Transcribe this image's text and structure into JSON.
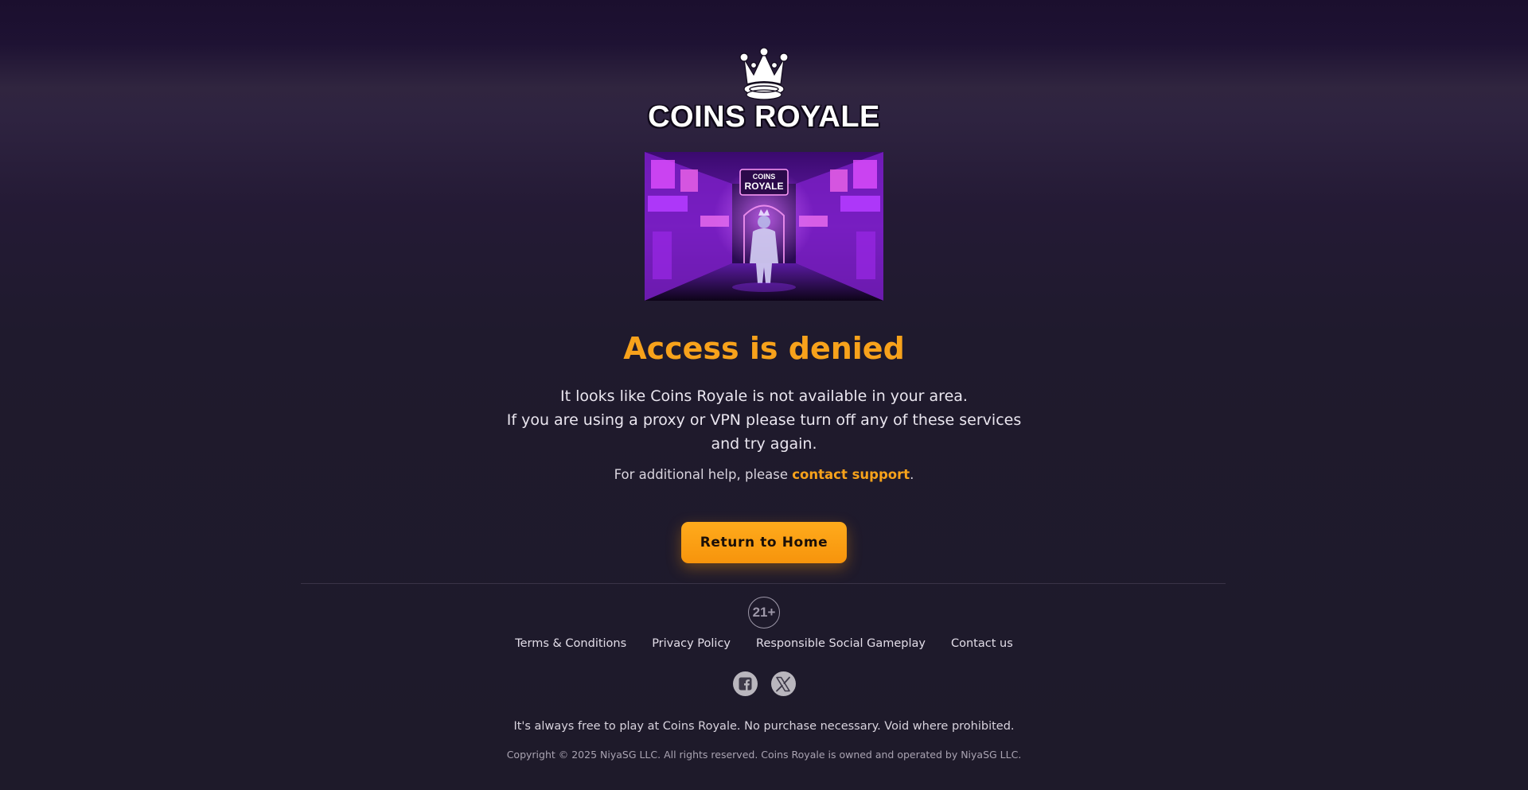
{
  "brand": {
    "name": "COINS ROYALE",
    "hero_sign_line1": "COINS",
    "hero_sign_line2": "ROYALE"
  },
  "main": {
    "title": "Access is denied",
    "message_line1": "It looks like Coins Royale is not available in your area.",
    "message_line2": "If you are using a proxy or VPN please turn off any of these services",
    "message_line3": "and try again.",
    "help_prefix": "For additional help, please ",
    "help_link": "contact support",
    "help_suffix": ".",
    "return_button": "Return to Home"
  },
  "footer": {
    "age_badge": "21+",
    "links": [
      "Terms & Conditions",
      "Privacy Policy",
      "Responsible Social Gameplay",
      "Contact us"
    ],
    "social_icons": [
      "facebook-icon",
      "x-icon"
    ],
    "free_play_notice": "It's always free to play at Coins Royale. No purchase necessary. Void where prohibited.",
    "copyright": "Copyright © 2025 NiyaSG LLC. All rights reserved. Coins Royale is owned and operated by NiyaSG LLC."
  },
  "colors": {
    "accent": "#f7a21b",
    "background": "#1e1a2a",
    "button": "#ffa412"
  }
}
